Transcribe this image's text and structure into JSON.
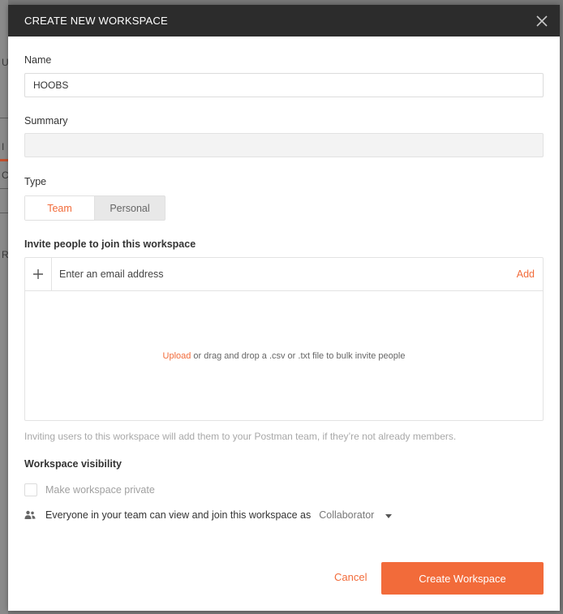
{
  "background": {
    "fragments": [
      "U",
      "I",
      "C",
      "R"
    ]
  },
  "dialog": {
    "title": "CREATE NEW WORKSPACE",
    "close_icon": "close-icon"
  },
  "form": {
    "name_label": "Name",
    "name_value": "HOOBS",
    "summary_label": "Summary",
    "summary_value": "",
    "type_label": "Type",
    "type_options": [
      "Team",
      "Personal"
    ],
    "type_selected": "Team",
    "invite_label": "Invite people to join this workspace",
    "email_placeholder": "Enter an email address",
    "add_label": "Add",
    "upload_label": "Upload",
    "drop_text": "or drag and drop a .csv or .txt file to bulk invite people",
    "invite_help": "Inviting users to this workspace will add them to your Postman team, if they’re not already members.",
    "visibility_label": "Workspace visibility",
    "private_checkbox_label": "Make workspace private",
    "private_checked": false,
    "visibility_text": "Everyone in your team can view and join this workspace as",
    "role_value": "Collaborator"
  },
  "actions": {
    "cancel_label": "Cancel",
    "create_label": "Create Workspace"
  },
  "colors": {
    "accent": "#f26b3a",
    "header_bg": "#2c2c2c"
  }
}
